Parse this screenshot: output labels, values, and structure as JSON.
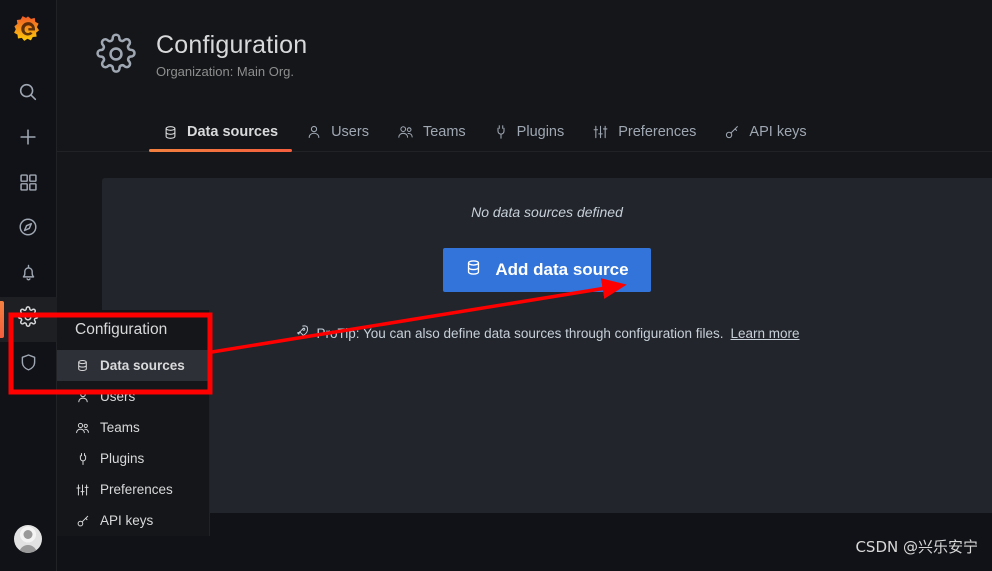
{
  "app": {
    "brand_icon": "grafana-logo-icon"
  },
  "sidebar": {
    "items": [
      {
        "icon": "search-icon",
        "name": "search"
      },
      {
        "icon": "plus-icon",
        "name": "create"
      },
      {
        "icon": "dashboards-icon",
        "name": "dashboards"
      },
      {
        "icon": "compass-icon",
        "name": "explore"
      },
      {
        "icon": "bell-icon",
        "name": "alerting"
      },
      {
        "icon": "gear-icon",
        "name": "configuration",
        "active": true
      },
      {
        "icon": "shield-icon",
        "name": "server-admin"
      }
    ],
    "avatar": "user-avatar"
  },
  "header": {
    "icon": "gear-icon",
    "title": "Configuration",
    "subtitle": "Organization: Main Org."
  },
  "tabs": [
    {
      "label": "Data sources",
      "icon": "database-icon",
      "active": true
    },
    {
      "label": "Users",
      "icon": "user-icon",
      "active": false
    },
    {
      "label": "Teams",
      "icon": "users-icon",
      "active": false
    },
    {
      "label": "Plugins",
      "icon": "plug-icon",
      "active": false
    },
    {
      "label": "Preferences",
      "icon": "sliders-icon",
      "active": false
    },
    {
      "label": "API keys",
      "icon": "key-icon",
      "active": false
    }
  ],
  "main": {
    "empty_message": "No data sources defined",
    "add_button": {
      "label": "Add data source",
      "icon": "database-icon",
      "color": "#3274d9"
    },
    "protip": {
      "icon": "rocket-icon",
      "text": "ProTip: You can also define data sources through configuration files.",
      "link_label": "Learn more"
    }
  },
  "flyout": {
    "title": "Configuration",
    "items": [
      {
        "label": "Data sources",
        "icon": "database-icon",
        "active": true
      },
      {
        "label": "Users",
        "icon": "user-icon",
        "active": false
      },
      {
        "label": "Teams",
        "icon": "users-icon",
        "active": false
      },
      {
        "label": "Plugins",
        "icon": "plug-icon",
        "active": false
      },
      {
        "label": "Preferences",
        "icon": "sliders-icon",
        "active": false
      },
      {
        "label": "API keys",
        "icon": "key-icon",
        "active": false
      }
    ]
  },
  "annotations": {
    "color": "#ff0000",
    "highlight_box": "red-rectangle-around-configuration-data-sources",
    "arrow": "red-arrow-to-add-data-source-button"
  },
  "watermark": {
    "text": "CSDN @兴乐安宁"
  }
}
